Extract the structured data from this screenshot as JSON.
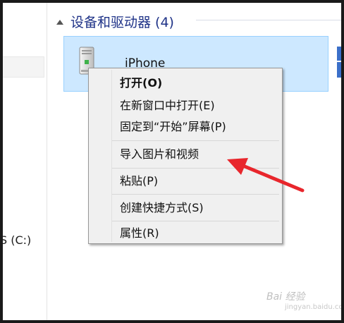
{
  "group": {
    "title": "设备和驱动器 (4)"
  },
  "device": {
    "name": "iPhone",
    "icon": "portable-device-icon"
  },
  "left_pane": {
    "drive_label": "S (C:)"
  },
  "context_menu": {
    "items": [
      {
        "label": "打开(O)",
        "bold": true
      },
      {
        "label": "在新窗口中打开(E)"
      },
      {
        "label": "固定到“开始”屏幕(P)"
      },
      {
        "label": "导入图片和视频"
      },
      {
        "label": "粘贴(P)"
      },
      {
        "label": "创建快捷方式(S)"
      },
      {
        "label": "属性(R)"
      }
    ]
  },
  "annotation": {
    "arrow_color": "#e8262c"
  },
  "watermark": {
    "text": "Bai 经验",
    "url": "jingyan.baidu.com"
  }
}
